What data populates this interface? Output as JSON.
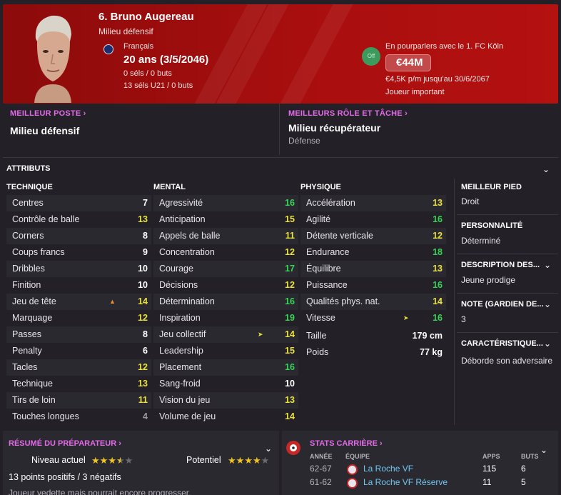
{
  "header": {
    "name": "6. Bruno Augereau",
    "position": "Milieu défensif",
    "nationality": "Français",
    "age": "20 ans (3/5/2046)",
    "caps": "0 séls / 0 buts",
    "caps_u21": "13 séls U21 / 0 buts",
    "offer_badge": "Off",
    "negotiation": "En pourparlers avec le 1. FC Köln",
    "value": "€44M",
    "wage": "€4,5K p/m jusqu'au 30/6/2067",
    "squad_status": "Joueur important"
  },
  "best_position": {
    "label": "MEILLEUR POSTE",
    "value": "Milieu défensif"
  },
  "best_role": {
    "label": "MEILLEURS RÔLE ET TÂCHE",
    "value": "Milieu récupérateur",
    "duty": "Défense"
  },
  "attributes_title": "ATTRIBUTS",
  "technique": {
    "title": "TECHNIQUE",
    "rows": [
      {
        "name": "Centres",
        "value": "7"
      },
      {
        "name": "Contrôle de balle",
        "value": "13"
      },
      {
        "name": "Corners",
        "value": "8"
      },
      {
        "name": "Coups francs",
        "value": "9"
      },
      {
        "name": "Dribbles",
        "value": "10"
      },
      {
        "name": "Finition",
        "value": "10"
      },
      {
        "name": "Jeu de tête",
        "value": "14"
      },
      {
        "name": "Marquage",
        "value": "12"
      },
      {
        "name": "Passes",
        "value": "8"
      },
      {
        "name": "Penalty",
        "value": "6"
      },
      {
        "name": "Tacles",
        "value": "12"
      },
      {
        "name": "Technique",
        "value": "13"
      },
      {
        "name": "Tirs de loin",
        "value": "11"
      },
      {
        "name": "Touches longues",
        "value": "4"
      }
    ]
  },
  "mental": {
    "title": "MENTAL",
    "rows": [
      {
        "name": "Agressivité",
        "value": "16"
      },
      {
        "name": "Anticipation",
        "value": "15"
      },
      {
        "name": "Appels de balle",
        "value": "11"
      },
      {
        "name": "Concentration",
        "value": "12"
      },
      {
        "name": "Courage",
        "value": "17"
      },
      {
        "name": "Décisions",
        "value": "12"
      },
      {
        "name": "Détermination",
        "value": "16"
      },
      {
        "name": "Inspiration",
        "value": "19"
      },
      {
        "name": "Jeu collectif",
        "value": "14"
      },
      {
        "name": "Leadership",
        "value": "15"
      },
      {
        "name": "Placement",
        "value": "16"
      },
      {
        "name": "Sang-froid",
        "value": "10"
      },
      {
        "name": "Vision du jeu",
        "value": "13"
      },
      {
        "name": "Volume de jeu",
        "value": "14"
      }
    ]
  },
  "physique": {
    "title": "PHYSIQUE",
    "rows": [
      {
        "name": "Accélération",
        "value": "13"
      },
      {
        "name": "Agilité",
        "value": "16"
      },
      {
        "name": "Détente verticale",
        "value": "12"
      },
      {
        "name": "Endurance",
        "value": "18"
      },
      {
        "name": "Équilibre",
        "value": "13"
      },
      {
        "name": "Puissance",
        "value": "16"
      },
      {
        "name": "Qualités phys. nat.",
        "value": "14"
      },
      {
        "name": "Vitesse",
        "value": "16"
      }
    ],
    "height_label": "Taille",
    "height_value": "179 cm",
    "weight_label": "Poids",
    "weight_value": "77 kg"
  },
  "side": {
    "foot_label": "MEILLEUR PIED",
    "foot_value": "Droit",
    "personality_label": "PERSONNALITÉ",
    "personality_value": "Déterminé",
    "description_label": "DESCRIPTION DES...",
    "description_value": "Jeune prodige",
    "note_label": "NOTE (GARDIEN DE...",
    "note_value": "3",
    "traits_label": "CARACTÉRISTIQUE...",
    "traits_value": "Déborde son adversaire"
  },
  "coach": {
    "label": "RÉSUMÉ DU PRÉPARATEUR",
    "current_label": "Niveau actuel",
    "current_stars": 3.5,
    "potential_label": "Potentiel",
    "potential_stars": 4,
    "points": "13 points positifs / 3 négatifs",
    "summary": "Joueur vedette mais pourrait encore progresser."
  },
  "career": {
    "label": "STATS CARRIÈRE",
    "col_year": "ANNÉE",
    "col_team": "ÉQUIPE",
    "col_apps": "APPS",
    "col_goals": "BUTS",
    "rows": [
      {
        "year": "62-67",
        "team": "La Roche VF",
        "apps": "115",
        "goals": "6"
      },
      {
        "year": "61-62",
        "team": "La Roche VF Réserve",
        "apps": "11",
        "goals": "5"
      }
    ]
  },
  "colors": {
    "header_red": "#a90e0e",
    "accent_pink": "#e36ae8",
    "attr_high": "#35d454",
    "attr_mid": "#e9e23a",
    "attr_low": "#ffffff",
    "attr_poor": "#9a97a0",
    "link_blue": "#6fc6f0"
  }
}
